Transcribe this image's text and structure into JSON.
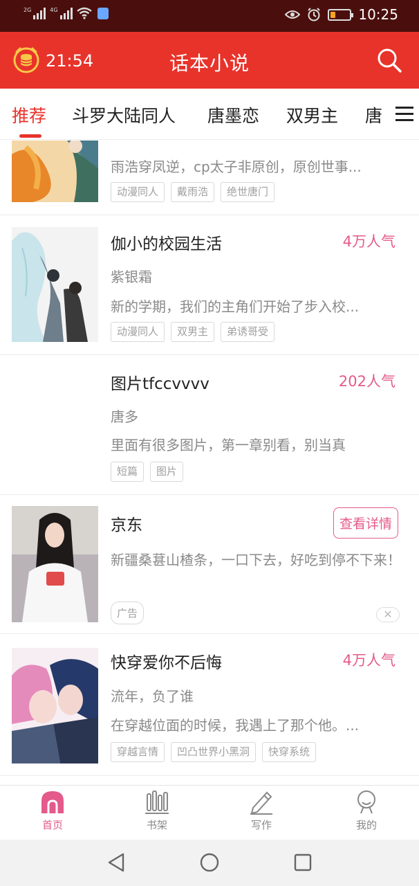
{
  "status_bar": {
    "signal1": "2G",
    "signal2": "4G",
    "time": "10:25"
  },
  "app_bar": {
    "timer_text": "21:54",
    "title": "话本小说"
  },
  "tabs": [
    {
      "label": "推荐",
      "active": true
    },
    {
      "label": "斗罗大陆同人",
      "active": false
    },
    {
      "label": "唐墨恋",
      "active": false
    },
    {
      "label": "双男主",
      "active": false
    },
    {
      "label": "唐",
      "active": false
    }
  ],
  "items": [
    {
      "title": "",
      "popularity": "",
      "author": "",
      "desc": "雨浩穿凤逆，cp太子非原创，原创世事...",
      "tags": [
        "动漫同人",
        "戴雨浩",
        "绝世唐门"
      ]
    },
    {
      "title": "伽小的校园生活",
      "popularity": "4万人气",
      "author": "紫银霜",
      "desc": "新的学期，我们的主角们开始了步入校...",
      "tags": [
        "动漫同人",
        "双男主",
        "弟诱哥受"
      ]
    },
    {
      "title": "图片tfccvvvv",
      "popularity": "202人气",
      "author": "唐多",
      "desc": "里面有很多图片，第一章别看，别当真",
      "tags": [
        "短篇",
        "图片"
      ]
    },
    {
      "title": "快穿爱你不后悔",
      "popularity": "4万人气",
      "author": "流年，负了谁",
      "desc": "在穿越位面的时候，我遇上了那个他。...",
      "tags": [
        "穿越言情",
        "凹凸世界小黑洞",
        "快穿系统"
      ]
    }
  ],
  "ad": {
    "title": "京东",
    "button_label": "查看详情",
    "desc": "新疆桑葚山楂条，一口下去，好吃到停不下来！",
    "tag": "广告",
    "close": "✕"
  },
  "bottom_nav": [
    {
      "label": "首页",
      "icon": "home-icon",
      "active": true
    },
    {
      "label": "书架",
      "icon": "bookshelf-icon",
      "active": false
    },
    {
      "label": "写作",
      "icon": "pencil-icon",
      "active": false
    },
    {
      "label": "我的",
      "icon": "profile-icon",
      "active": false
    }
  ],
  "colors": {
    "accent": "#e8332a",
    "popularity": "#e45a8a",
    "status_bar": "#4a0f0d"
  }
}
